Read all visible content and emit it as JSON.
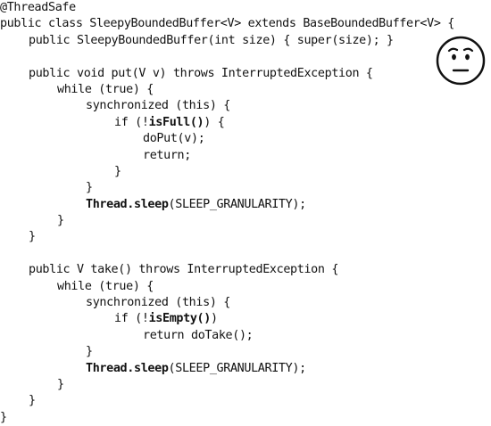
{
  "code": {
    "l1": "@ThreadSafe",
    "l2": "public class SleepyBoundedBuffer<V> extends BaseBoundedBuffer<V> {",
    "l3": "public SleepyBoundedBuffer(int size) { super(size); }",
    "l5": "public void put(V v) throws InterruptedException {",
    "l6": "while (true) {",
    "l7": "synchronized (this) {",
    "l8_a": "if (!",
    "l8_b": "isFull()",
    "l8_c": ") {",
    "l9": "doPut(v);",
    "l10": "return;",
    "l11": "}",
    "l12": "}",
    "l13_a": "Thread.sleep",
    "l13_b": "(SLEEP_GRANULARITY);",
    "l14": "}",
    "l15": "}",
    "l17": "public V take() throws InterruptedException {",
    "l18": "while (true) {",
    "l19": "synchronized (this) {",
    "l20_a": "if (!",
    "l20_b": "isEmpty()",
    "l20_c": ")",
    "l21": "return doTake();",
    "l22": "}",
    "l23_a": "Thread.sleep",
    "l23_b": "(SLEEP_GRANULARITY);",
    "l24": "}",
    "l25": "}",
    "l26": "}"
  },
  "icon": {
    "name": "skeptical-face-icon"
  }
}
